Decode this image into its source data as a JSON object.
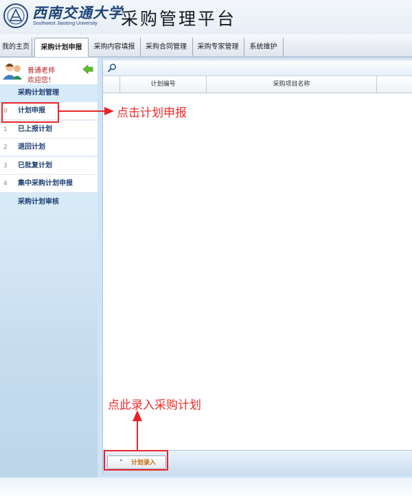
{
  "header": {
    "university_cn": "西南交通大学",
    "university_en": "Southwest Jiaotong University",
    "app_title": "采购管理平台"
  },
  "nav": {
    "tabs": [
      {
        "label": "我的主页",
        "active": false
      },
      {
        "label": "采购计划申报",
        "active": true
      },
      {
        "label": "采购内容填报",
        "active": false
      },
      {
        "label": "采购合同管理",
        "active": false
      },
      {
        "label": "采购专家管理",
        "active": false
      },
      {
        "label": "系统维护",
        "active": false
      }
    ]
  },
  "user": {
    "name": "普通老师",
    "greeting": "欢迎您！"
  },
  "sidebar": {
    "section_top": "采购计划管理",
    "items": [
      {
        "num": "0",
        "label": "计划申报"
      },
      {
        "num": "1",
        "label": "已上报计划"
      },
      {
        "num": "2",
        "label": "退回计划"
      },
      {
        "num": "3",
        "label": "已批复计划"
      },
      {
        "num": "4",
        "label": "集中采购计划申报"
      }
    ],
    "section_bottom": "采购计划审核"
  },
  "grid": {
    "columns": [
      "计划编号",
      "采购项目名称"
    ]
  },
  "bottom": {
    "button_label": "计划录入",
    "caret": "˄"
  },
  "annotations": {
    "click_plan": "点击计划申报",
    "enter_plan": "点此录入采购计划"
  },
  "colors": {
    "annotation_red": "#e8222a",
    "brand_blue": "#21457a",
    "menu_text": "#1e3f74"
  }
}
